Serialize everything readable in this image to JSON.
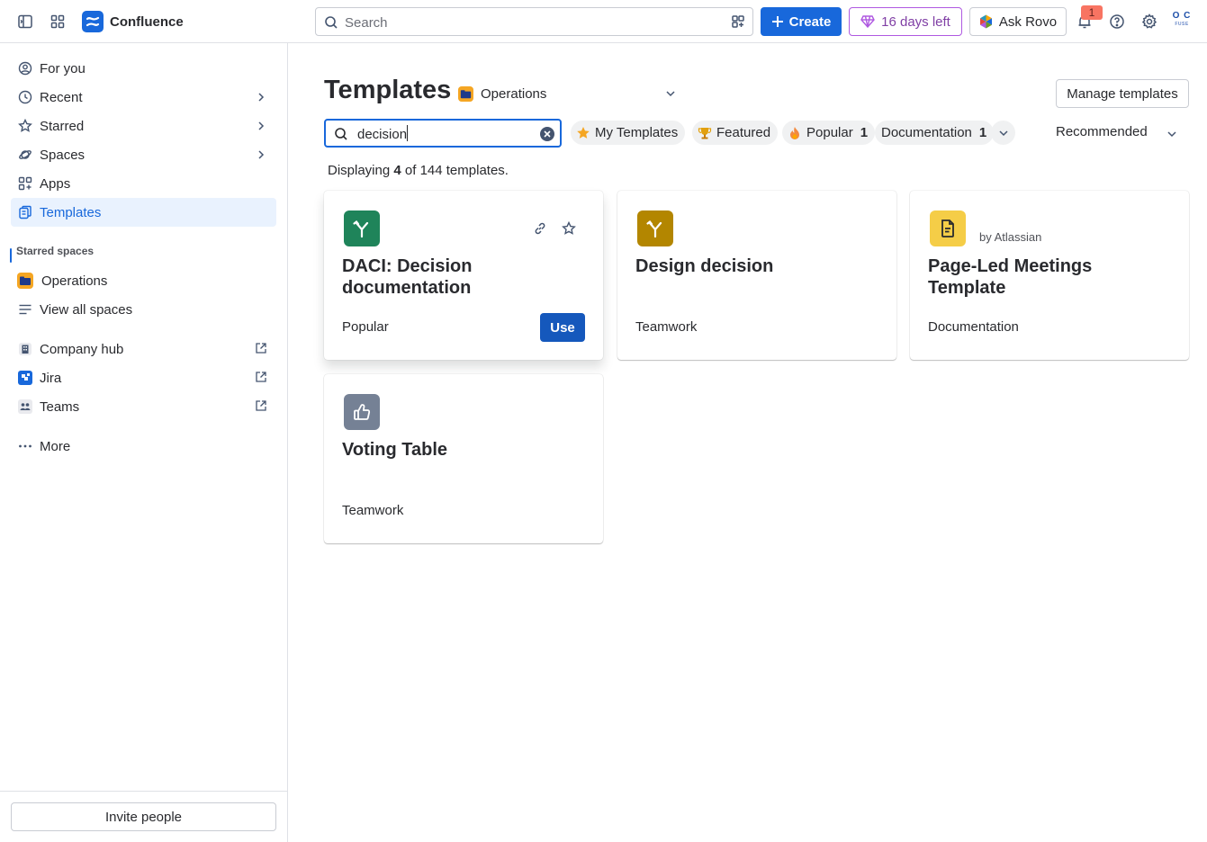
{
  "topbar": {
    "app_name": "Confluence",
    "search_placeholder": "Search",
    "create_label": "Create",
    "trial_label": "16 days left",
    "rovo_label": "Ask Rovo",
    "notification_count": "1",
    "avatar_initials_top": "O C",
    "avatar_initials_bottom": "FUSE",
    "brand_color": "#1868DB"
  },
  "sidebar": {
    "items": [
      {
        "label": "For you",
        "icon": "user-circle-icon"
      },
      {
        "label": "Recent",
        "icon": "clock-icon"
      },
      {
        "label": "Starred",
        "icon": "star-icon"
      },
      {
        "label": "Spaces",
        "icon": "planet-icon"
      },
      {
        "label": "Apps",
        "icon": "apps-icon"
      },
      {
        "label": "Templates",
        "icon": "template-icon"
      }
    ],
    "starred_spaces_heading": "Starred spaces",
    "starred_spaces": [
      {
        "label": "Operations",
        "icon": "operations-space-icon"
      },
      {
        "label": "View all spaces",
        "icon": "list-icon"
      }
    ],
    "links": [
      {
        "label": "Company hub",
        "icon": "building-icon"
      },
      {
        "label": "Jira",
        "icon": "jira-icon"
      },
      {
        "label": "Teams",
        "icon": "teams-icon"
      }
    ],
    "more_label": "More",
    "invite_label": "Invite people"
  },
  "main": {
    "title": "Templates",
    "space_selector": "Operations",
    "manage_label": "Manage templates",
    "search_value": "decision",
    "filters": [
      {
        "label": "My Templates",
        "count": "",
        "icon": "star-filled-icon"
      },
      {
        "label": "Featured",
        "count": "",
        "icon": "trophy-icon"
      },
      {
        "label": "Popular",
        "count": "1",
        "icon": "fire-icon"
      },
      {
        "label": "Documentation",
        "count": "1",
        "icon": ""
      }
    ],
    "sort_label": "Recommended",
    "results": {
      "prefix": "Displaying",
      "shown": "4",
      "middle": "of 144 templates."
    },
    "cards": [
      {
        "title": "DACI: Decision documentation",
        "category": "Popular",
        "author": "",
        "icon": "decision-branch-icon",
        "icon_color": "#1F845A",
        "use_label": "Use"
      },
      {
        "title": "Design decision",
        "category": "Teamwork",
        "author": "",
        "icon": "decision-branch-icon",
        "icon_color": "#B38600"
      },
      {
        "title": "Page-Led Meetings Template",
        "category": "Documentation",
        "author": "by Atlassian",
        "icon": "document-icon",
        "icon_color": "#F5CD47"
      },
      {
        "title": "Voting Table",
        "category": "Teamwork",
        "author": "",
        "icon": "thumbs-up-icon",
        "icon_color": "#758195"
      }
    ]
  }
}
